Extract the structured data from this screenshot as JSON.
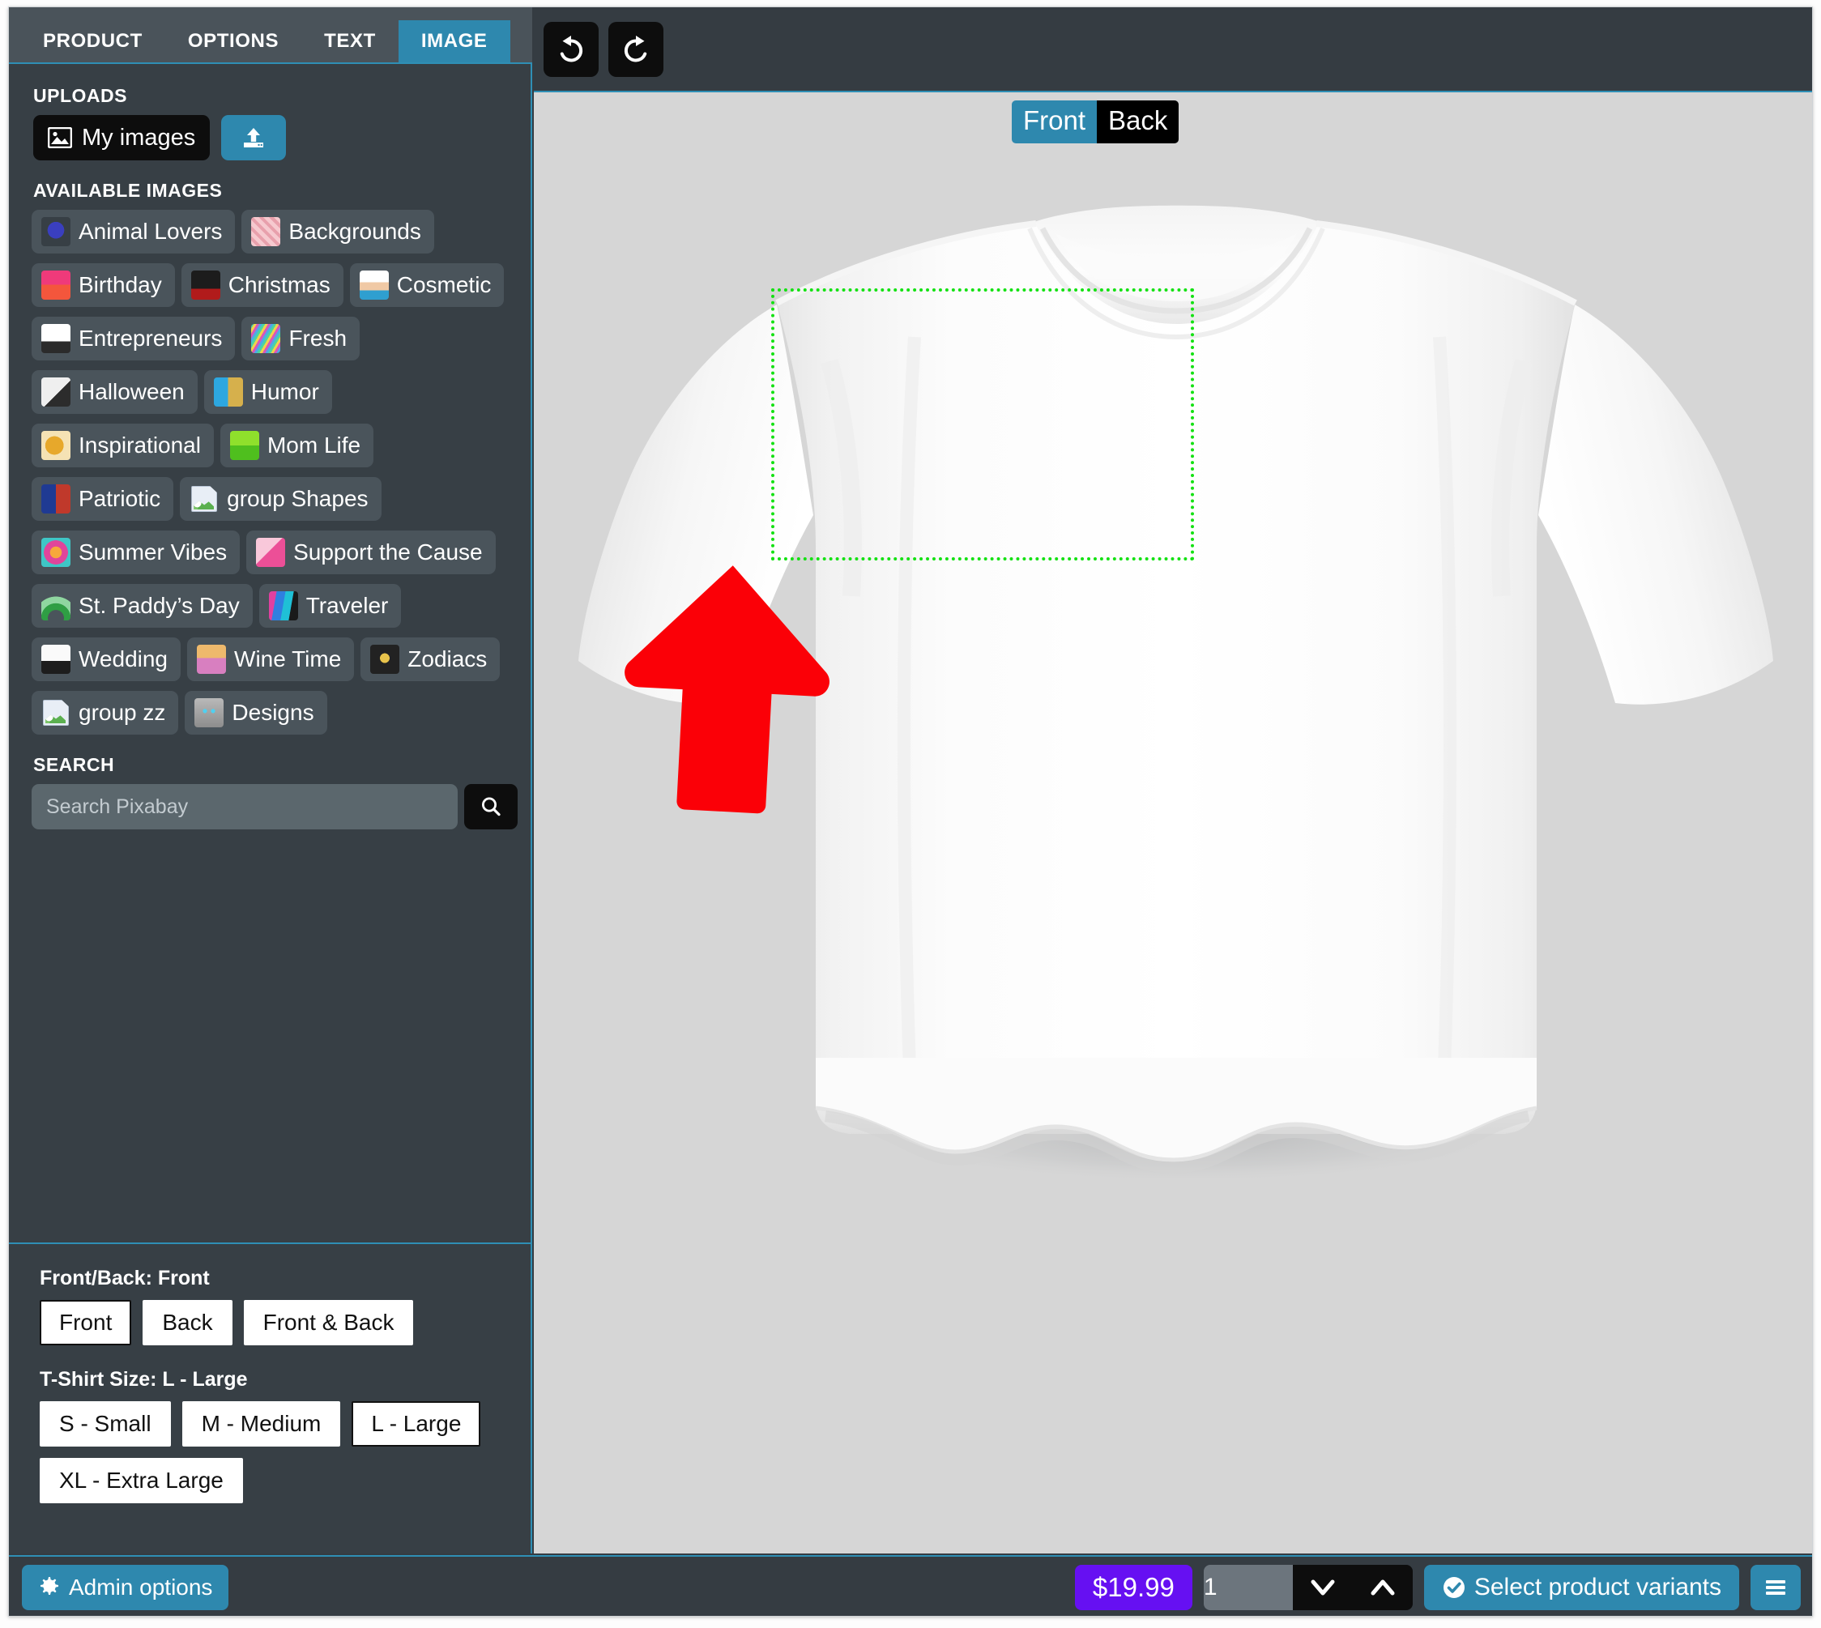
{
  "tabs": [
    {
      "label": "PRODUCT",
      "active": false
    },
    {
      "label": "OPTIONS",
      "active": false
    },
    {
      "label": "TEXT",
      "active": false
    },
    {
      "label": "IMAGE",
      "active": true
    }
  ],
  "sidebar": {
    "uploads_label": "UPLOADS",
    "my_images_label": "My images",
    "upload_icon": "upload-icon",
    "my_images_icon": "image-icon",
    "available_images_label": "AVAILABLE IMAGES",
    "categories": [
      {
        "label": "Animal Lovers",
        "icon": "paw-heart-thumb",
        "broken": false
      },
      {
        "label": "Backgrounds",
        "icon": "pink-pattern-thumb",
        "broken": false
      },
      {
        "label": "Birthday",
        "icon": "birthday-babe-thumb",
        "broken": false
      },
      {
        "label": "Christmas",
        "icon": "big-christmas-thumb",
        "broken": false
      },
      {
        "label": "Cosmetic",
        "icon": "mua-eye-thumb",
        "broken": false
      },
      {
        "label": "Entrepreneurs",
        "icon": "your-logo-here-thumb",
        "broken": false
      },
      {
        "label": "Fresh",
        "icon": "confetti-thumb",
        "broken": false
      },
      {
        "label": "Halloween",
        "icon": "oct-31-thumb",
        "broken": false
      },
      {
        "label": "Humor",
        "icon": "try-jesus-thumb",
        "broken": false
      },
      {
        "label": "Inspirational",
        "icon": "bee-honeycomb-thumb",
        "broken": false
      },
      {
        "label": "Mom Life",
        "icon": "fly-as-a-mother-thumb",
        "broken": false
      },
      {
        "label": "Patriotic",
        "icon": "merica-glasses-thumb",
        "broken": false
      },
      {
        "label": "group Shapes",
        "icon": "broken-image-icon",
        "broken": true
      },
      {
        "label": "Summer Vibes",
        "icon": "summer-vibes-thumb",
        "broken": false
      },
      {
        "label": "Support the Cause",
        "icon": "pink-ribbon-thumb",
        "broken": false
      },
      {
        "label": "St. Paddy’s Day",
        "icon": "green-rainbow-thumb",
        "broken": false
      },
      {
        "label": "Traveler",
        "icon": "world-map-thumb",
        "broken": false
      },
      {
        "label": "Wedding",
        "icon": "i-love-us-thumb",
        "broken": false
      },
      {
        "label": "Wine Time",
        "icon": "mermaid-wine-thumb",
        "broken": false
      },
      {
        "label": "Zodiacs",
        "icon": "virgo-queen-thumb",
        "broken": false
      },
      {
        "label": "group zz",
        "icon": "broken-image-icon",
        "broken": true
      },
      {
        "label": "Designs",
        "icon": "cat-face-thumb",
        "broken": false
      }
    ],
    "search_label": "SEARCH",
    "search_placeholder": "Search Pixabay",
    "search_value": "",
    "search_icon": "magnifier-icon"
  },
  "product_options": {
    "front_back_title": "Front/Back: Front",
    "front_back_buttons": [
      {
        "label": "Front",
        "selected": true
      },
      {
        "label": "Back",
        "selected": false
      },
      {
        "label": "Front & Back",
        "selected": false
      }
    ],
    "size_title": "T-Shirt Size: L - Large",
    "size_buttons": [
      {
        "label": "S - Small",
        "selected": false
      },
      {
        "label": "M - Medium",
        "selected": false
      },
      {
        "label": "L - Large",
        "selected": true
      },
      {
        "label": "XL - Extra Large",
        "selected": false
      }
    ]
  },
  "canvas": {
    "undo_icon": "undo-icon",
    "redo_icon": "redo-icon",
    "view_toggle": [
      {
        "label": "Front",
        "active": true
      },
      {
        "label": "Back",
        "active": false
      }
    ],
    "print_area_color": "#14e113",
    "artwork": {
      "name": "red-up-arrow",
      "color": "#fb0007"
    },
    "product_name": "white-t-shirt-mockup",
    "background_color": "#d6d6d6"
  },
  "bottom_bar": {
    "admin_label": "Admin options",
    "admin_icon": "gear-icon",
    "price": "$19.99",
    "quantity": "1",
    "qty_down_icon": "chevron-down-icon",
    "qty_up_icon": "chevron-up-icon",
    "variants_label": "Select product variants",
    "variants_icon": "check-circle-icon",
    "menu_icon": "hamburger-menu-icon"
  },
  "colors": {
    "accent": "#2e88ae",
    "panel": "#373f45",
    "chip": "#4a545b",
    "price": "#6610f2",
    "arrow": "#fb0007",
    "print_border": "#14e113"
  }
}
